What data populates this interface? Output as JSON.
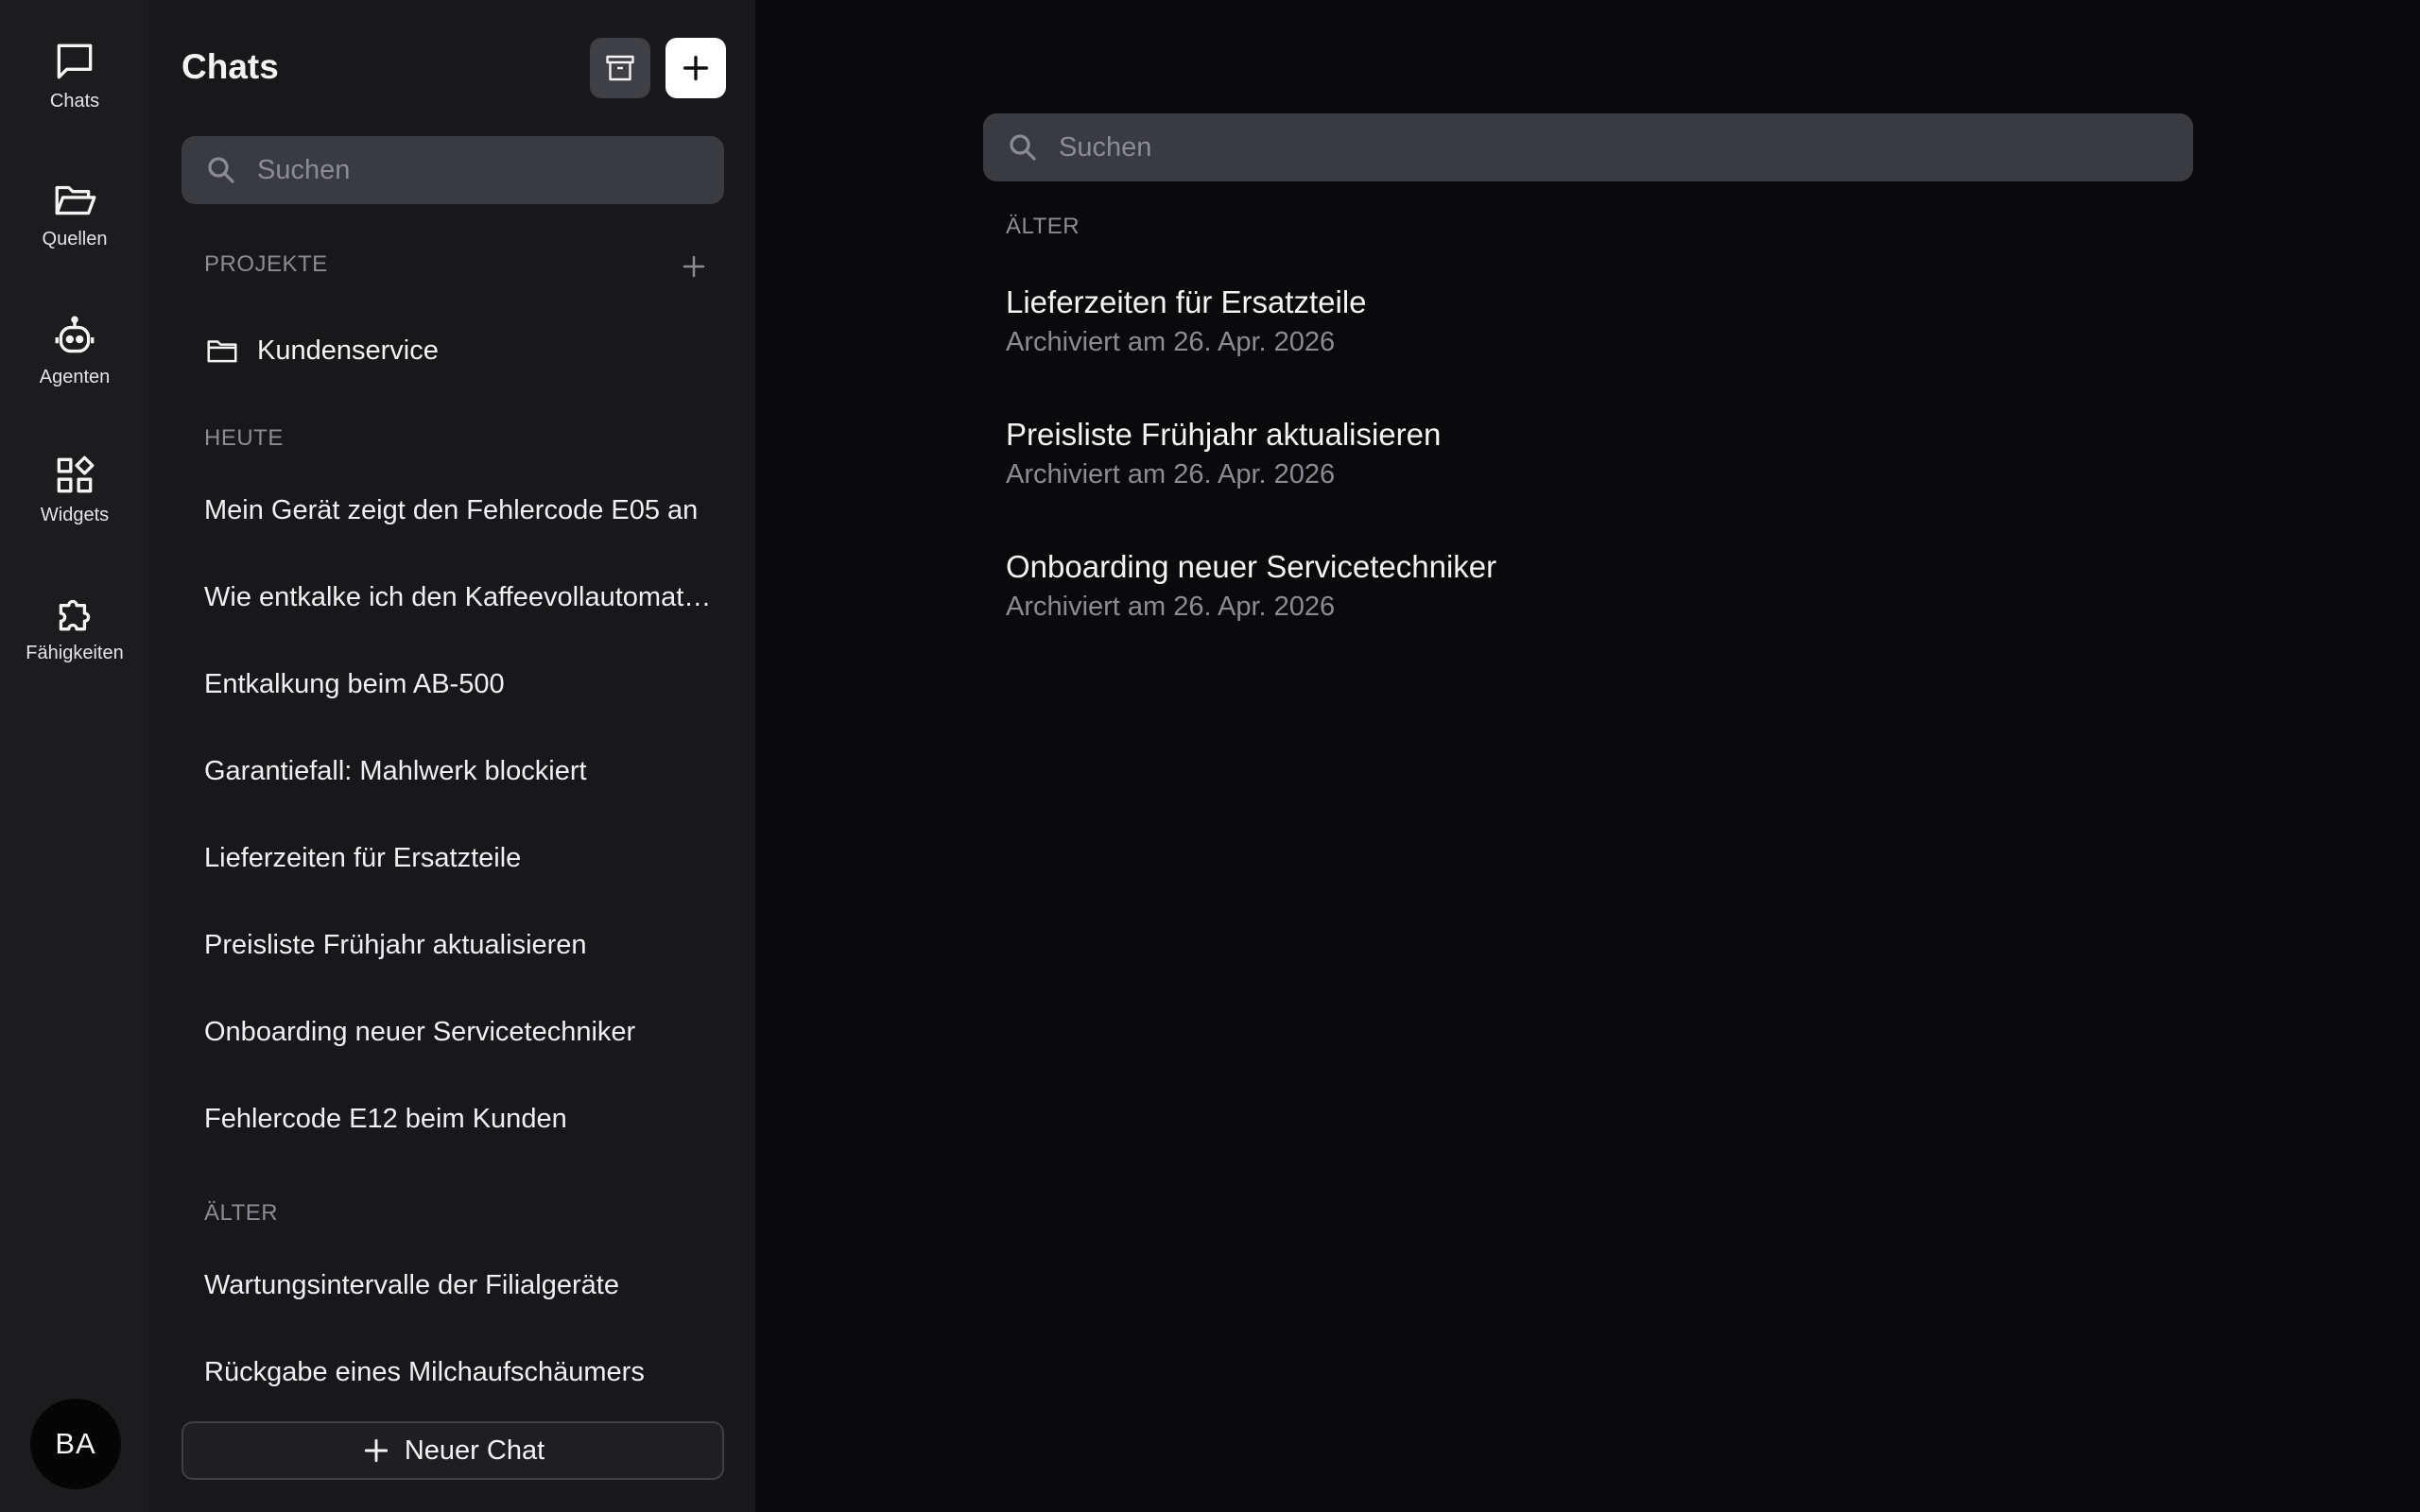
{
  "rail": {
    "items": [
      {
        "label": "Chats",
        "icon": "chat-bubble-icon"
      },
      {
        "label": "Quellen",
        "icon": "folder-open-icon"
      },
      {
        "label": "Agenten",
        "icon": "robot-icon"
      },
      {
        "label": "Widgets",
        "icon": "widgets-icon"
      },
      {
        "label": "Fähigkeiten",
        "icon": "puzzle-icon"
      }
    ],
    "avatar_initials": "BA"
  },
  "sidebar": {
    "title": "Chats",
    "search_placeholder": "Suchen",
    "projects_label": "PROJEKTE",
    "projects": [
      {
        "label": "Kundenservice"
      }
    ],
    "today_label": "HEUTE",
    "today_chats": [
      "Mein Gerät zeigt den Fehlercode E05 an",
      "Wie entkalke ich den Kaffeevollautomaten?",
      "Entkalkung beim AB-500",
      "Garantiefall: Mahlwerk blockiert",
      "Lieferzeiten für Ersatzteile",
      "Preisliste Frühjahr aktualisieren",
      "Onboarding neuer Servicetechniker",
      "Fehlercode E12 beim Kunden"
    ],
    "older_label": "ÄLTER",
    "older_chats": [
      "Wartungsintervalle der Filialgeräte",
      "Rückgabe eines Milchaufschäumers"
    ],
    "new_chat_label": "Neuer Chat"
  },
  "main": {
    "search_placeholder": "Suchen",
    "section_label": "ÄLTER",
    "archived": [
      {
        "title": "Lieferzeiten für Ersatzteile",
        "date": "Archiviert am 26. Apr. 2026"
      },
      {
        "title": "Preisliste Frühjahr aktualisieren",
        "date": "Archiviert am 26. Apr. 2026"
      },
      {
        "title": "Onboarding neuer Servicetechniker",
        "date": "Archiviert am 26. Apr. 2026"
      }
    ]
  },
  "colors": {
    "rail_bg": "#1c1c1f",
    "sidebar_bg": "#18181b",
    "main_bg": "#0a0a0c",
    "search_bg": "#3a3a41",
    "muted_text": "#8b8b93"
  }
}
